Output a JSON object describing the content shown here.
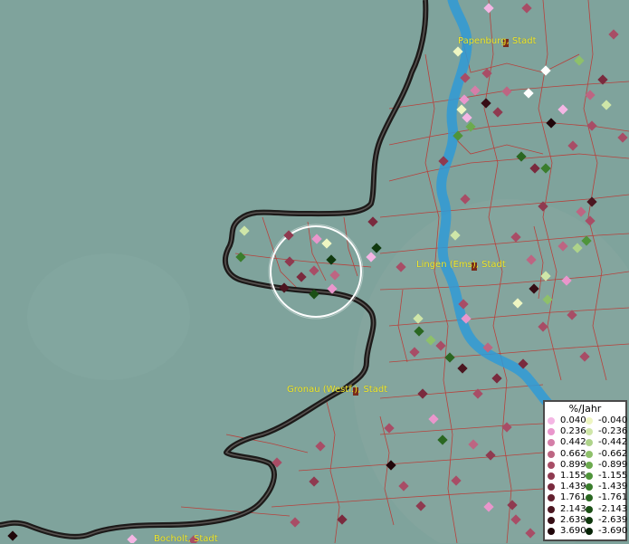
{
  "map": {
    "cities": [
      {
        "id": "papenburg",
        "label": "Papenburg, Stadt"
      },
      {
        "id": "lingen",
        "label": "Lingen (Ems), Stadt"
      },
      {
        "id": "gronau",
        "label": "Gronau (Westf.), Stadt"
      },
      {
        "id": "bocholt",
        "label": "Bocholt, Stadt"
      }
    ]
  },
  "legend": {
    "title": "%/Jahr",
    "positive": [
      {
        "label": "0.040",
        "color": "#f4b6e4"
      },
      {
        "label": "0.236",
        "color": "#e996cc"
      },
      {
        "label": "0.442",
        "color": "#d47ea8"
      },
      {
        "label": "0.662",
        "color": "#bd6582"
      },
      {
        "label": "0.899",
        "color": "#a84d66"
      },
      {
        "label": "1.155",
        "color": "#8f3a50"
      },
      {
        "label": "1.439",
        "color": "#7a2a3e"
      },
      {
        "label": "1.761",
        "color": "#63202e"
      },
      {
        "label": "2.143",
        "color": "#4b1620"
      },
      {
        "label": "2.639",
        "color": "#360e15"
      },
      {
        "label": "3.690",
        "color": "#20060a"
      }
    ],
    "negative": [
      {
        "label": "-0.040",
        "color": "#eef6c2"
      },
      {
        "label": "-0.236",
        "color": "#cfe6a8"
      },
      {
        "label": "-0.442",
        "color": "#aed38a"
      },
      {
        "label": "-0.662",
        "color": "#8ec06a"
      },
      {
        "label": "-0.899",
        "color": "#6caa4e"
      },
      {
        "label": "-1.155",
        "color": "#4f943a"
      },
      {
        "label": "-1.439",
        "color": "#3a7d2c"
      },
      {
        "label": "-1.761",
        "color": "#2a6721"
      },
      {
        "label": "-2.143",
        "color": "#1c5016"
      },
      {
        "label": "-2.639",
        "color": "#10390e"
      },
      {
        "label": "-3.690",
        "color": "#062306"
      }
    ]
  }
}
